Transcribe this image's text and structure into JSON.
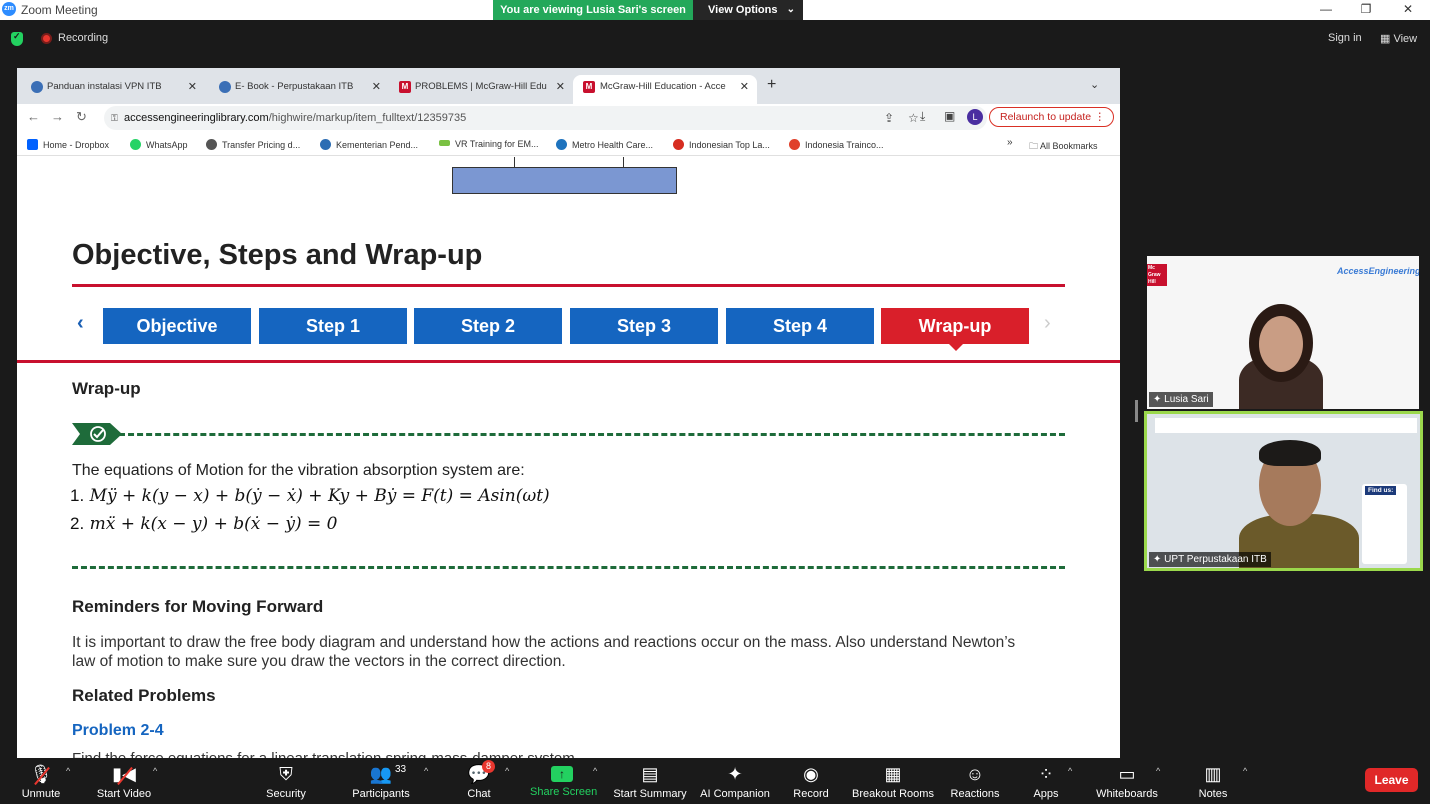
{
  "zoom": {
    "window_title": "Zoom Meeting",
    "viewing_banner": "You are viewing Lusia Sari's screen",
    "view_options": "View Options",
    "recording": "Recording",
    "sign_in": "Sign in",
    "view": "View",
    "leave": "Leave"
  },
  "browser": {
    "tabs": [
      {
        "label": "Panduan instalasi VPN ITB"
      },
      {
        "label": "E- Book - Perpustakaan ITB"
      },
      {
        "label": "PROBLEMS | McGraw-Hill Edu"
      },
      {
        "label": "McGraw-Hill Education - Acce"
      }
    ],
    "url_host": "accessengineeringlibrary.com",
    "url_path": "/highwire/markup/item_fulltext/12359735",
    "relaunch": "Relaunch to update",
    "avatar_letter": "L",
    "bookmarks": [
      {
        "label": "Home - Dropbox",
        "color": "#0061fe"
      },
      {
        "label": "WhatsApp",
        "color": "#25d366"
      },
      {
        "label": "Transfer Pricing d...",
        "color": "#555555"
      },
      {
        "label": "Kementerian Pend...",
        "color": "#2c6db3"
      },
      {
        "label": "VR Training for EM...",
        "color": "#7ac143"
      },
      {
        "label": "Metro Health Care...",
        "color": "#1e73be"
      },
      {
        "label": "Indonesian Top La...",
        "color": "#d62d20"
      },
      {
        "label": "Indonesia Trainco...",
        "color": "#e0402a"
      }
    ],
    "all_bookmarks": "All Bookmarks"
  },
  "page": {
    "title": "Objective, Steps and Wrap-up",
    "steps": [
      {
        "label": "Objective",
        "active": false
      },
      {
        "label": "Step 1",
        "active": false
      },
      {
        "label": "Step 2",
        "active": false
      },
      {
        "label": "Step 3",
        "active": false
      },
      {
        "label": "Step 4",
        "active": false
      },
      {
        "label": "Wrap-up",
        "active": true
      }
    ],
    "wrap_heading": "Wrap-up",
    "equations_intro": "The equations of Motion for the vibration absorption system are:",
    "equations": [
      {
        "num": "1.",
        "text": "Mÿ + k(y − x) + b(ẏ − ẋ) + Ky + Bẏ = F(t) = Asin(ωt)"
      },
      {
        "num": "2.",
        "text": "mẍ + k(x − y) + b(ẋ − ẏ) = 0"
      }
    ],
    "reminders_heading": "Reminders for Moving Forward",
    "reminders_text": "It is important to draw the free body diagram and understand how the actions and reactions occur on the mass. Also understand Newton’s law of motion to make sure you draw the vectors in the correct direction.",
    "related_heading": "Related Problems",
    "problem_link": "Problem 2-4",
    "cut_text": "Find the force equations for a linear translation spring-mass-damper system"
  },
  "participants_tiles": [
    {
      "name": "Lusia Sari"
    },
    {
      "name": "UPT Perpustakaan ITB"
    }
  ],
  "tile_texts": {
    "access": "AccessEngineering",
    "mh": "Mc Graw Hill",
    "find_us": "Find us:"
  },
  "toolbar": {
    "items": [
      {
        "label": "Unmute",
        "icon": "microphone-muted-icon"
      },
      {
        "label": "Start Video",
        "icon": "video-off-icon"
      },
      {
        "label": "Security",
        "icon": "shield-icon"
      },
      {
        "label": "Participants",
        "icon": "participants-icon"
      },
      {
        "label": "Chat",
        "icon": "chat-icon"
      },
      {
        "label": "Share Screen",
        "icon": "share-screen-icon"
      },
      {
        "label": "Start Summary",
        "icon": "summary-icon"
      },
      {
        "label": "AI Companion",
        "icon": "sparkle-icon"
      },
      {
        "label": "Record",
        "icon": "record-icon"
      },
      {
        "label": "Breakout Rooms",
        "icon": "breakout-rooms-icon"
      },
      {
        "label": "Reactions",
        "icon": "reactions-icon"
      },
      {
        "label": "Apps",
        "icon": "apps-icon"
      },
      {
        "label": "Whiteboards",
        "icon": "whiteboard-icon"
      },
      {
        "label": "Notes",
        "icon": "notes-icon"
      }
    ],
    "participants_count": "33",
    "chat_badge": "8"
  }
}
